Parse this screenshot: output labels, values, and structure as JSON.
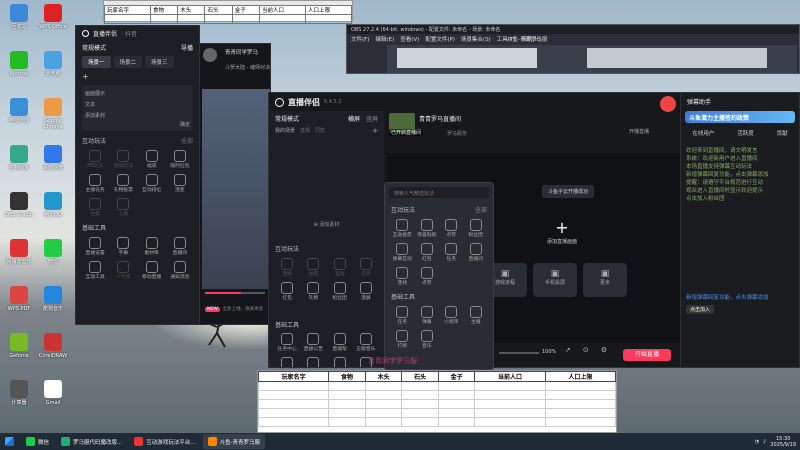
{
  "desktop": {
    "icons": [
      {
        "label": "回收站",
        "color": "#3b8ad9"
      },
      {
        "label": "WPS Office",
        "color": "#d22"
      },
      {
        "label": "Wechat",
        "color": "#2b2"
      },
      {
        "label": "此电脑",
        "color": "#4aa3e0"
      },
      {
        "label": "哔哩哔哩",
        "color": "#3a8fd8"
      },
      {
        "label": "Google Chrome",
        "color": "#e94"
      },
      {
        "label": "控制面板",
        "color": "#3a8"
      },
      {
        "label": "百度网盘",
        "color": "#37e"
      },
      {
        "label": "OBS Studio",
        "color": "#333"
      },
      {
        "label": "腾讯QQ",
        "color": "#29c"
      },
      {
        "label": "网易云音乐",
        "color": "#d33"
      },
      {
        "label": "微信",
        "color": "#2c4"
      },
      {
        "label": "WPS PDF",
        "color": "#d44"
      },
      {
        "label": "酷狗音乐",
        "color": "#28d"
      },
      {
        "label": "Geforce",
        "color": "#7b2"
      },
      {
        "label": "CorelDRAW",
        "color": "#c33"
      },
      {
        "label": "计算器",
        "color": "#555"
      },
      {
        "label": "Gmail",
        "color": "#fff"
      }
    ]
  },
  "top_sheet": {
    "title": "罗马服代码魔改 ...",
    "row1": [
      "玩家名字",
      "食物",
      "木头",
      "石头",
      "金子",
      "当前人口",
      "人口上限"
    ],
    "row2": [
      "",
      "",
      "",
      "",
      "",
      "",
      ""
    ]
  },
  "obs": {
    "title": "OBS 27.2.4 (64-bit, windows) - 配置文件: 未命名 - 场景: 未命名",
    "menu": [
      "文件(F)",
      "编辑(E)",
      "查看(V)",
      "配置文件(P)",
      "场景集合(S)",
      "工具(T)",
      "帮助(H)"
    ],
    "extra": "斗鱼-青青罗马服"
  },
  "small_companion": {
    "title": "直播伴侣",
    "subtitle": "· 抖音",
    "mode": "常规模式",
    "guide": "导播",
    "scene_tabs": [
      "场景一",
      "场景二",
      "场景三"
    ],
    "add": "+",
    "rows": [
      "画面展示",
      "文本",
      "添加素材"
    ],
    "confirm": "确定",
    "interact_title": "互动玩法",
    "all": "全部",
    "interact_tools": [
      "PK玩法",
      "连线玩法",
      "福袋",
      "限时红包",
      "主播任务",
      "礼物投票",
      "互动排位",
      "连麦",
      "主题",
      "心愿"
    ],
    "basic_title": "基础工具",
    "basic_tools": [
      "直播设置",
      "字幕",
      "素材库",
      "直播间",
      "互动工具",
      "人气宝",
      "移动直播",
      "通知消息"
    ],
    "streamer": "青青同学罗马",
    "audience": "斗罗大陆 - 魂师对决",
    "new_badge": "NEW",
    "new_text": "全新上线，快来体验"
  },
  "companion": {
    "title": "直播伴侣",
    "version": "6.4.5.2",
    "mode": "常规模式",
    "top_actions": [
      "横屏",
      "竖屏"
    ],
    "scene_label": "我的场景",
    "scene_chips": [
      "直播",
      "同款"
    ],
    "add_source": "添加素材",
    "interact_title": "互动玩法",
    "interact_tools": [
      "连线",
      "福袋",
      "互动",
      "任务",
      "红包",
      "礼物",
      "粉丝团",
      "连屏"
    ],
    "basic_title": "基础工具",
    "basic_tools": [
      "任务中心",
      "直播公告",
      "直播帮",
      "正版音乐",
      "弹幕设置",
      "直播数据",
      "机器人",
      "下播关注"
    ],
    "streamer": "青青罗马直播间",
    "live_label": "已开启直播间",
    "sub_label": "罗马服务",
    "top_right": [
      "开播直播",
      "观看者",
      "关注者"
    ],
    "popup": "斗鱼子云开播成功",
    "add_screen": "添加直播画面",
    "screen_buttons": [
      "游戏进程",
      "手机投屏",
      "更多"
    ],
    "search_placeholder": "搜索人气精选玩法",
    "zoom": "100%",
    "start_button": "开始直播",
    "danmaku_overlay": "弹幕玩法"
  },
  "popup": {
    "search": "搜索人气精选玩法",
    "interact_title": "互动玩法",
    "all": "全部",
    "tools": [
      "互动投票",
      "惊喜贴纸",
      "点赞",
      "粉丝团",
      "弹幕互动",
      "红包",
      "任务",
      "直播间",
      "连线",
      "点赞"
    ],
    "basic_title": "基础工具",
    "basic_tools": [
      "任务",
      "弹幕",
      "小程序",
      "主播",
      "打榜",
      "音乐"
    ]
  },
  "danmaku": {
    "title": "弹幕助手",
    "tabs": [
      "在线用户",
      "活跃度",
      "贡献"
    ],
    "banner": "斗鱼潜力主播签约政策",
    "lines": [
      "欢迎来到直播间，请文明发言",
      "系统：欢迎新用户进入直播间",
      "本场直播支持弹幕互动玩法",
      "新增弹幕回复功能，点击弹幕添加",
      "提醒：请遵守平台规范进行互动",
      "观众进入直播间时显示欢迎提示",
      "点击加入粉丝团"
    ],
    "highlight": "新增弹幕回复功能，点击弹幕添加",
    "footer": "点击加入"
  },
  "sheet": {
    "headers": [
      "玩家名字",
      "食物",
      "木头",
      "石头",
      "金子",
      "当前人口",
      "人口上限"
    ],
    "rows": 5,
    "watermark": "青青同学罗马服"
  },
  "taskbar": {
    "items": [
      {
        "label": "微信",
        "color": "#2c4"
      },
      {
        "label": "罗马服代码魔改版...",
        "color": "#2a7"
      },
      {
        "label": "互动游戏玩法平台...",
        "color": "#e33"
      },
      {
        "label": "斗鱼-青青罗马服",
        "color": "#f80"
      }
    ],
    "time": "15:30",
    "date": "2025/9/19"
  }
}
